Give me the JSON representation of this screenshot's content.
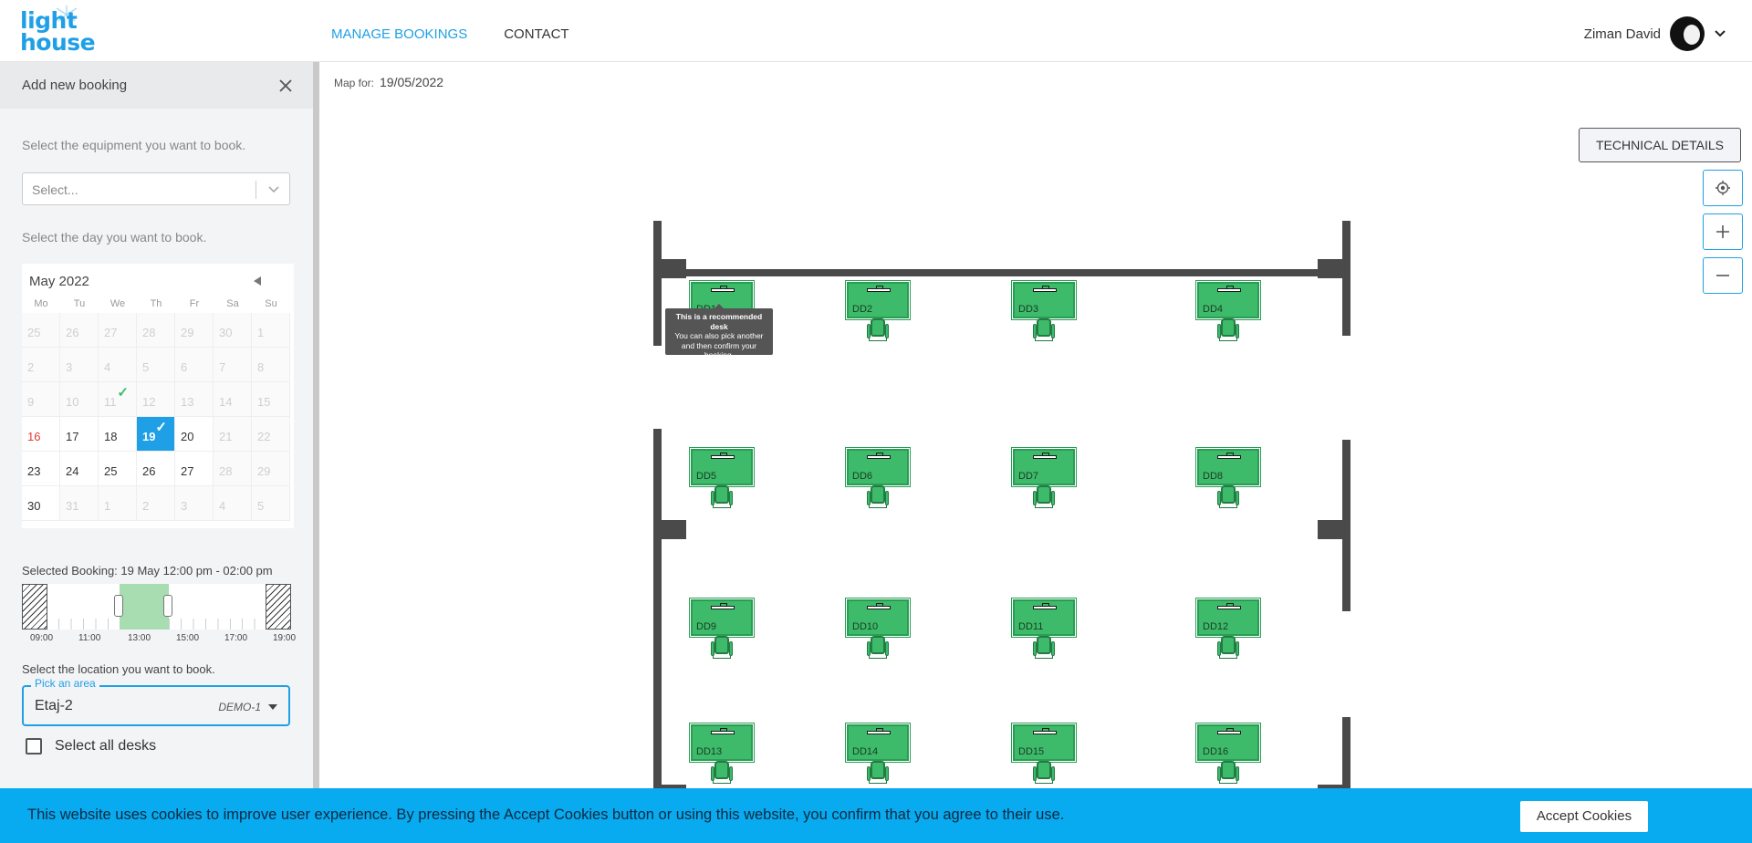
{
  "header": {
    "logo_line1": "light",
    "logo_line2": "house",
    "nav": {
      "manage_bookings": "MANAGE BOOKINGS",
      "contact": "CONTACT"
    },
    "user_name": "Ziman David"
  },
  "sidebar": {
    "title": "Add new booking",
    "equipment_label": "Select the equipment you want to book.",
    "equipment_placeholder": "Select...",
    "day_label": "Select the day you want to book.",
    "calendar": {
      "month": "May 2022",
      "weekdays": [
        "Mo",
        "Tu",
        "We",
        "Th",
        "Fr",
        "Sa",
        "Su"
      ],
      "weeks": [
        [
          {
            "d": "25",
            "t": "dim"
          },
          {
            "d": "26",
            "t": "dim"
          },
          {
            "d": "27",
            "t": "dim"
          },
          {
            "d": "28",
            "t": "dim"
          },
          {
            "d": "29",
            "t": "dim"
          },
          {
            "d": "30",
            "t": "dim"
          },
          {
            "d": "1",
            "t": "dim"
          }
        ],
        [
          {
            "d": "2",
            "t": "dim"
          },
          {
            "d": "3",
            "t": "dim"
          },
          {
            "d": "4",
            "t": "dim"
          },
          {
            "d": "5",
            "t": "dim"
          },
          {
            "d": "6",
            "t": "dim"
          },
          {
            "d": "7",
            "t": "dim"
          },
          {
            "d": "8",
            "t": "dim"
          }
        ],
        [
          {
            "d": "9",
            "t": "dim"
          },
          {
            "d": "10",
            "t": "dim"
          },
          {
            "d": "11",
            "t": "dim",
            "check": true
          },
          {
            "d": "12",
            "t": "dim"
          },
          {
            "d": "13",
            "t": "dim"
          },
          {
            "d": "14",
            "t": "dim"
          },
          {
            "d": "15",
            "t": "dim"
          }
        ],
        [
          {
            "d": "16",
            "t": "today"
          },
          {
            "d": "17",
            "t": ""
          },
          {
            "d": "18",
            "t": ""
          },
          {
            "d": "19",
            "t": "sel",
            "check": true
          },
          {
            "d": "20",
            "t": ""
          },
          {
            "d": "21",
            "t": "dim"
          },
          {
            "d": "22",
            "t": "dim"
          }
        ],
        [
          {
            "d": "23",
            "t": ""
          },
          {
            "d": "24",
            "t": ""
          },
          {
            "d": "25",
            "t": ""
          },
          {
            "d": "26",
            "t": ""
          },
          {
            "d": "27",
            "t": ""
          },
          {
            "d": "28",
            "t": "dim"
          },
          {
            "d": "29",
            "t": "dim"
          }
        ],
        [
          {
            "d": "30",
            "t": ""
          },
          {
            "d": "31",
            "t": "dim"
          },
          {
            "d": "1",
            "t": "dim"
          },
          {
            "d": "2",
            "t": "dim"
          },
          {
            "d": "3",
            "t": "dim"
          },
          {
            "d": "4",
            "t": "dim"
          },
          {
            "d": "5",
            "t": "dim"
          }
        ]
      ]
    },
    "selected_booking": "Selected Booking: 19 May 12:00 pm - 02:00 pm",
    "timeline_labels": [
      "09:00",
      "11:00",
      "13:00",
      "15:00",
      "17:00",
      "19:00"
    ],
    "location_label": "Select the location you want to book.",
    "area_legend": "Pick an area",
    "area_value": "Etaj-2",
    "area_tag": "DEMO-1",
    "select_all": "Select all desks"
  },
  "map": {
    "map_for_label": "Map for:",
    "map_date": "19/05/2022",
    "technical_details": "TECHNICAL DETAILS",
    "desks": [
      "DD1",
      "DD2",
      "DD3",
      "DD4",
      "DD5",
      "DD6",
      "DD7",
      "DD8",
      "DD9",
      "DD10",
      "DD11",
      "DD12",
      "DD13",
      "DD14",
      "DD15",
      "DD16"
    ],
    "tooltip_line1": "This is a recommended desk",
    "tooltip_line2": "You can also pick another and then confirm your booking."
  },
  "cookie": {
    "text": "This website uses cookies to improve user experience. By pressing the Accept Cookies button or using this website, you confirm that you agree to their use.",
    "button": "Accept Cookies"
  },
  "colors": {
    "accent": "#1fa0e6",
    "desk": "#3dbb6a",
    "cookie_bar": "#08aaf0"
  }
}
